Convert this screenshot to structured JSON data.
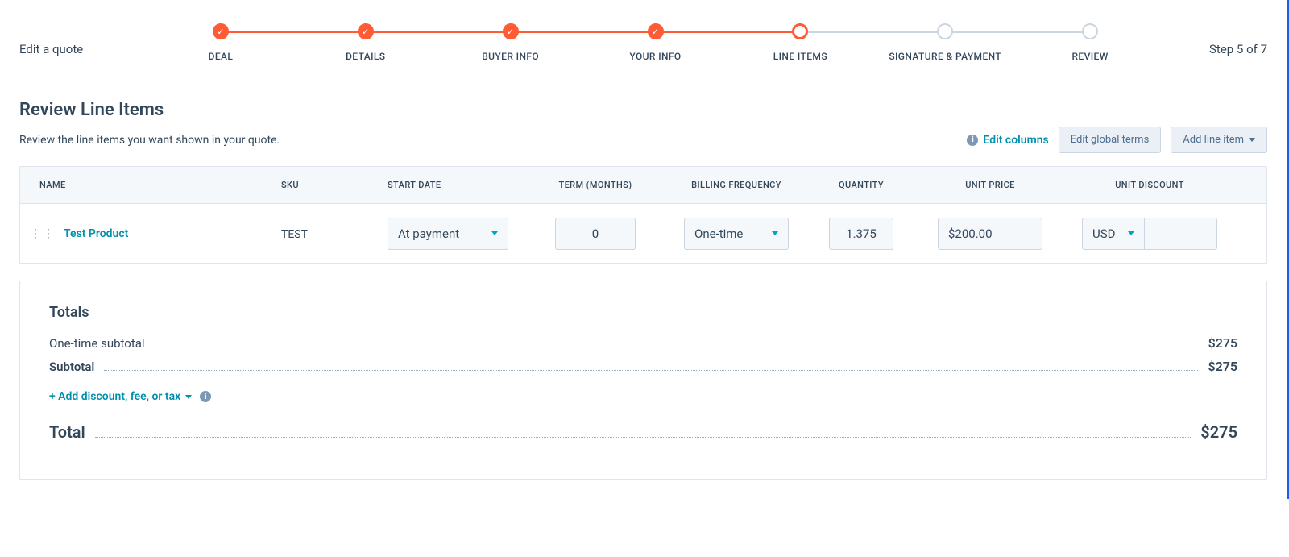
{
  "header": {
    "title": "Edit a quote",
    "step_count_label": "Step 5 of 7",
    "steps": [
      {
        "label": "DEAL",
        "state": "done"
      },
      {
        "label": "DETAILS",
        "state": "done"
      },
      {
        "label": "BUYER INFO",
        "state": "done"
      },
      {
        "label": "YOUR INFO",
        "state": "done"
      },
      {
        "label": "LINE ITEMS",
        "state": "current"
      },
      {
        "label": "SIGNATURE & PAYMENT",
        "state": "future"
      },
      {
        "label": "REVIEW",
        "state": "future"
      }
    ]
  },
  "main": {
    "title": "Review Line Items",
    "subtitle": "Review the line items you want shown in your quote.",
    "actions": {
      "edit_columns": "Edit columns",
      "edit_global_terms": "Edit global terms",
      "add_line_item": "Add line item"
    }
  },
  "table": {
    "columns": {
      "name": "NAME",
      "sku": "SKU",
      "start_date": "START DATE",
      "term": "TERM (MONTHS)",
      "billing_frequency": "BILLING FREQUENCY",
      "quantity": "QUANTITY",
      "unit_price": "UNIT PRICE",
      "unit_discount": "UNIT DISCOUNT"
    },
    "rows": [
      {
        "name": "Test Product",
        "sku": "TEST",
        "start_date": "At payment",
        "term": "0",
        "billing_frequency": "One-time",
        "quantity": "1.375",
        "unit_price": "$200.00",
        "unit_discount_currency": "USD",
        "unit_discount_value": ""
      }
    ]
  },
  "totals": {
    "title": "Totals",
    "one_time_label": "One-time subtotal",
    "one_time_value": "$275",
    "subtotal_label": "Subtotal",
    "subtotal_value": "$275",
    "add_discount_label": "+ Add discount, fee, or tax",
    "total_label": "Total",
    "total_value": "$275"
  }
}
